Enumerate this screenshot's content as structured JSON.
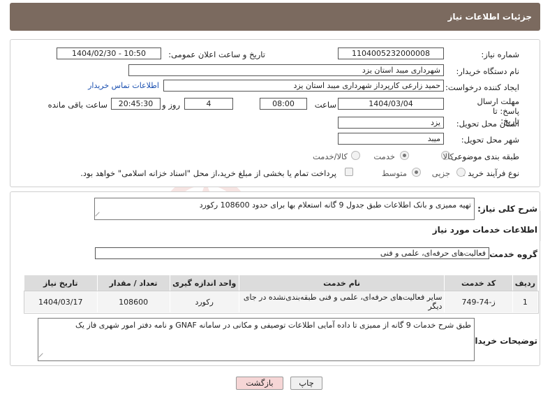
{
  "header": {
    "title": "جزئیات اطلاعات نیاز"
  },
  "labels": {
    "need_number": "شماره نیاز:",
    "announce_datetime": "تاریخ و ساعت اعلان عمومی:",
    "buyer_org": "نام دستگاه خریدار:",
    "requester": "ایجاد کننده درخواست:",
    "contact_link": "اطلاعات تماس خریدار",
    "deadline": "مهلت ارسال پاسخ: تا تاریخ:",
    "time_word": "ساعت",
    "day_word": "روز و",
    "remaining_word": "ساعت باقی مانده",
    "province": "استان محل تحویل:",
    "city": "شهر محل تحویل:",
    "category": "طبقه بندی موضوعی:",
    "process_type": "نوع فرآیند خرید :",
    "payment_note": "پرداخت تمام یا بخشی از مبلغ خرید،از محل \"اسناد خزانه اسلامی\" خواهد بود.",
    "general_desc": "شرح کلی نیاز:",
    "services_info": "اطلاعات خدمات مورد نیاز",
    "service_group": "گروه خدمت:",
    "buyer_notes": "توضیحات خریدار:"
  },
  "fields": {
    "need_number": "1104005232000008",
    "announce_datetime": "1404/02/30 - 10:50",
    "buyer_org": "شهرداری میبد استان یزد",
    "requester": "حمید زارعی کارپرداز شهرداری میبد استان یزد",
    "deadline_date": "1404/03/04",
    "deadline_time": "08:00",
    "remaining_days": "4",
    "remaining_time": "20:45:30",
    "province": "یزد",
    "city": "میبد",
    "general_desc": "تهیه ممیزی و بانک اطلاعات طبق جدول 9 گانه استعلام بها برای حدود 108600 رکورد",
    "service_group": "فعالیت‌های حرفه‌ای، علمی و فنی",
    "buyer_notes": "طبق شرح خدمات 9 گانه از ممیزی تا داده آمایی اطلاعات توصیفی و مکانی در سامانه GNAF و نامه دفتر امور شهری فاز یک"
  },
  "category_options": {
    "goods": "کالا",
    "service": "خدمت",
    "goods_service": "کالا/خدمت",
    "selected": "service"
  },
  "process_options": {
    "partial": "جزیی",
    "medium": "متوسط",
    "selected": "medium"
  },
  "table": {
    "headers": {
      "row": "ردیف",
      "code": "کد خدمت",
      "name": "نام خدمت",
      "unit": "واحد اندازه گیری",
      "qty": "تعداد / مقدار",
      "date": "تاریخ نیاز"
    },
    "rows": [
      {
        "row": "1",
        "code": "ز-74-749",
        "name": "سایر فعالیت‌های حرفه‌ای، علمی و فنی طبقه‌بندی‌نشده در جای دیگر",
        "unit": "رکورد",
        "qty": "108600",
        "date": "1404/03/17"
      }
    ]
  },
  "buttons": {
    "print": "چاپ",
    "back": "بازگشت"
  },
  "watermark": {
    "text": "AriaTender.neT"
  },
  "colors": {
    "header_bg": "#7b6a5f",
    "back_button_bg": "#f6d6d6",
    "link": "#1a4fb0",
    "watermark": "#c0392b"
  }
}
